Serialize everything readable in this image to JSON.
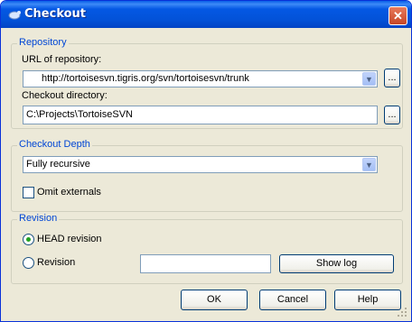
{
  "window": {
    "title": "Checkout",
    "close_glyph": "✕"
  },
  "repository": {
    "group_label": "Repository",
    "url_label": "URL of repository:",
    "url_value": "http://tortoisesvn.tigris.org/svn/tortoisesvn/trunk",
    "url_browse": "...",
    "dir_label": "Checkout directory:",
    "dir_value": "C:\\Projects\\TortoiseSVN",
    "dir_browse": "..."
  },
  "depth": {
    "group_label": "Checkout Depth",
    "selected": "Fully recursive",
    "omit_externals_label": "Omit externals",
    "omit_externals_checked": false
  },
  "revision": {
    "group_label": "Revision",
    "head_label": "HEAD revision",
    "head_selected": true,
    "revision_label": "Revision",
    "revision_value": "",
    "show_log": "Show log"
  },
  "buttons": {
    "ok": "OK",
    "cancel": "Cancel",
    "help": "Help"
  },
  "icons": {
    "app": "turtle-icon",
    "dropdown": "chevron-down-icon"
  }
}
